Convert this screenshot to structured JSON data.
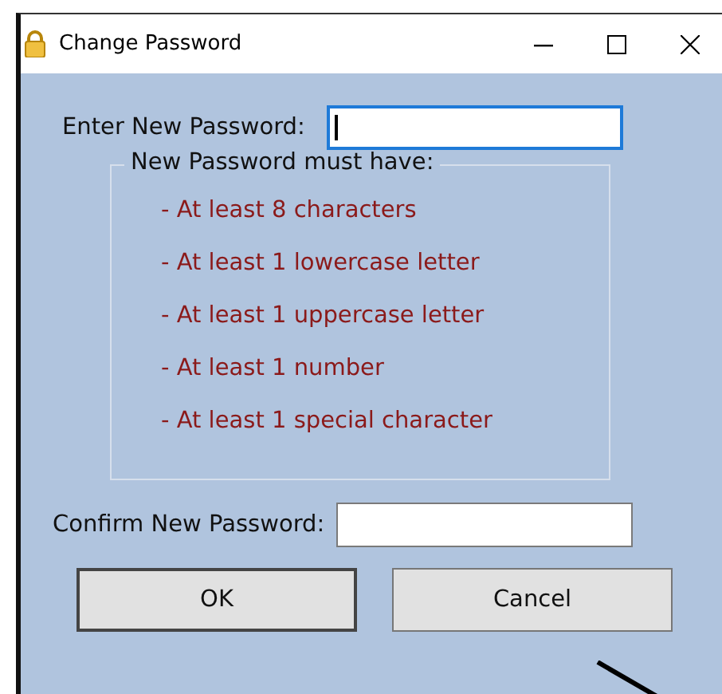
{
  "window": {
    "title": "Change Password"
  },
  "new_password": {
    "label": "Enter New Password:",
    "focused": true
  },
  "requirements": {
    "title": "New Password must have:",
    "items": [
      {
        "text": "- At least 8 characters"
      },
      {
        "text": "- At least 1 lowercase letter"
      },
      {
        "text": "- At least 1 uppercase letter"
      },
      {
        "text": "- At least 1 number"
      },
      {
        "text": "- At least 1 special character"
      }
    ]
  },
  "confirm_password": {
    "label": "Confirm New Password:",
    "focused": false
  },
  "buttons": [
    {
      "label": "OK",
      "default": true
    },
    {
      "label": "Cancel",
      "default": false
    }
  ]
}
